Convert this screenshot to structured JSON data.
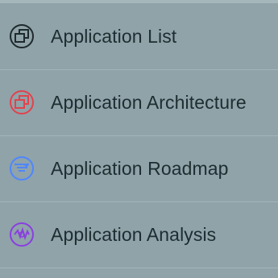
{
  "menu": {
    "items": [
      {
        "label": "Application List",
        "icon": "application-list-icon",
        "icon_color": "#1f2a2d"
      },
      {
        "label": "Application Architecture",
        "icon": "application-architecture-icon",
        "icon_color": "#e2424c"
      },
      {
        "label": "Application Roadmap",
        "icon": "application-roadmap-icon",
        "icon_color": "#4f86ff"
      },
      {
        "label": "Application Analysis",
        "icon": "application-analysis-icon",
        "icon_color": "#8a3fe0"
      }
    ]
  }
}
